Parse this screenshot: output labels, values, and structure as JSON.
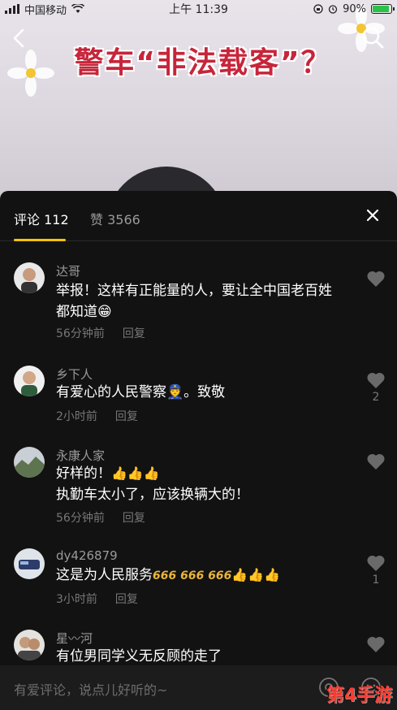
{
  "status_bar": {
    "carrier": "中国移动",
    "time": "上午 11:39",
    "battery": "90%",
    "battery_level": 0.9
  },
  "video": {
    "title": "警车“非法载客”？"
  },
  "tabs": {
    "comments": "评论 112",
    "likes": "赞 3566"
  },
  "comments": [
    {
      "user": "达哥",
      "text_line1": "举报！这样有正能量的人，要让全中国老百姓",
      "text_line2": "都知道",
      "time": "56分钟前",
      "reply": "回复",
      "likes": ""
    },
    {
      "user": "乡下人",
      "text": "有爱心的人民警察",
      "text_after": "。致敬",
      "time": "2小时前",
      "reply": "回复",
      "likes": "2"
    },
    {
      "user": "永康人家",
      "text_line1": "好样的！",
      "text_line2": "执勤车太小了，应该换辆大的！",
      "time": "56分钟前",
      "reply": "回复",
      "likes": ""
    },
    {
      "user": "dy426879",
      "text": "这是为人民服务",
      "time": "3小时前",
      "reply": "回复",
      "likes": "1"
    },
    {
      "user": "星〰河",
      "text": "有位男同学义无反顾的走了",
      "likes": ""
    }
  ],
  "input": {
    "placeholder": "有爱评论，说点儿好听的~"
  },
  "watermark": "第4手游",
  "colors": {
    "accent": "#ffc300",
    "title_red": "#c7253a",
    "panel_bg": "#121212"
  }
}
